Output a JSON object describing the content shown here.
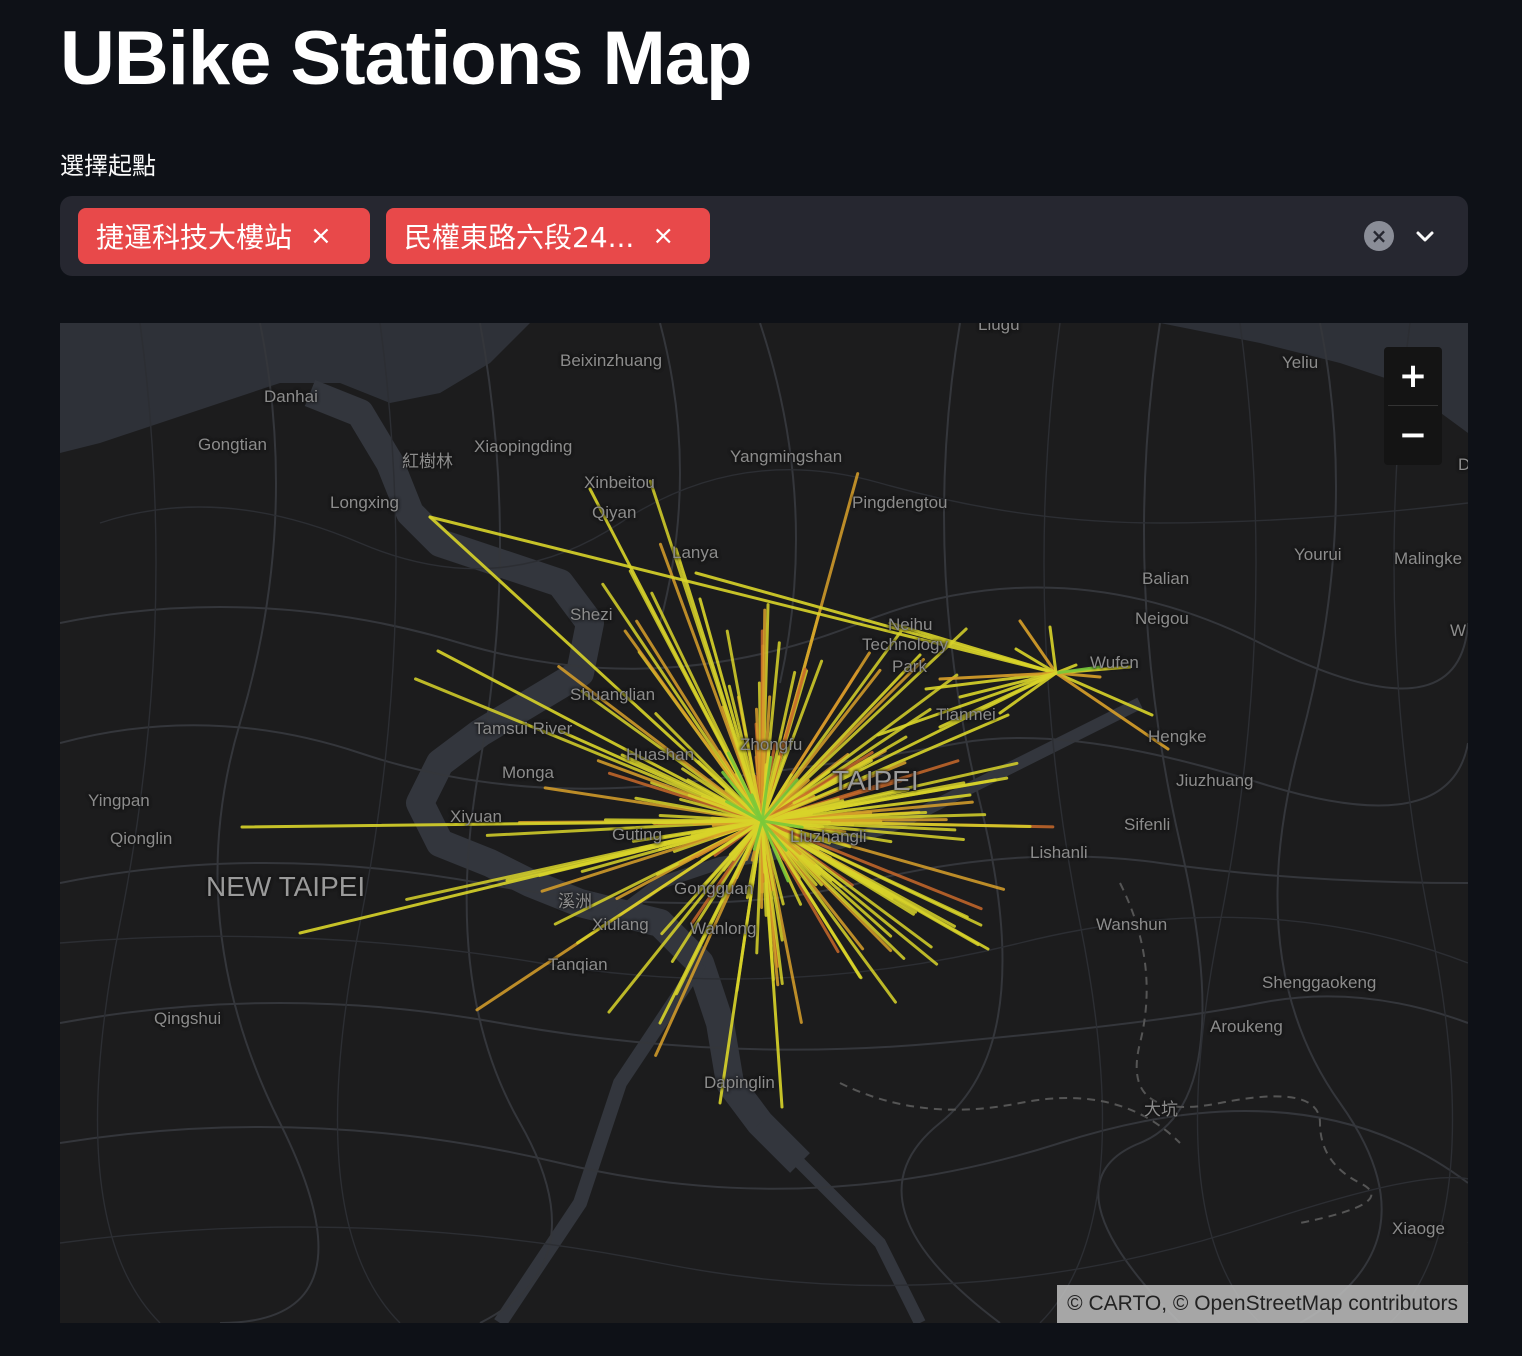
{
  "app": {
    "title": "UBike Stations Map"
  },
  "selector": {
    "label": "選擇起點",
    "selected": [
      {
        "label": "捷運科技大樓站"
      },
      {
        "label": "民權東路六段24..."
      }
    ],
    "remove_glyph": "×",
    "clear_glyph": "×"
  },
  "map": {
    "zoom_in": "+",
    "zoom_out": "−",
    "attribution": "© CARTO, © OpenStreetMap contributors",
    "labels": [
      "Liugu",
      "Beixinzhuang",
      "Yeliu",
      "Danhai",
      "Gongtian",
      "紅樹林",
      "Xiaopingding",
      "Yangmingshan",
      "Xinbeitou",
      "Longxing",
      "Qiyan",
      "Pingdengtou",
      "Lanya",
      "Yourui",
      "Malingke",
      "Balian",
      "Shezi",
      "Neigou",
      "Neihu",
      "Technology",
      "Park",
      "Wufen",
      "W",
      "D",
      "Shuanglian",
      "Tamsui River",
      "Tianmei",
      "Hengke",
      "Huashan",
      "Zhongfu",
      "Monga",
      "TAIPEI",
      "Jiuzhuang",
      "Yingpan",
      "Xiyuan",
      "Sifenli",
      "Qionglin",
      "Guting",
      "Liuzhangli",
      "Lishanli",
      "NEW TAIPEI",
      "溪洲",
      "Gongguan",
      "Xiulang",
      "Wanlong",
      "Wanshun",
      "Tanqian",
      "Shenggaokeng",
      "Qingshui",
      "Aroukeng",
      "Dapinglin",
      "大坑",
      "Xiaoge"
    ],
    "route_colors": {
      "main": "#d9d42a",
      "mid": "#d9a02a",
      "alt": "#c8692a",
      "accent": "#7ac93a"
    }
  }
}
